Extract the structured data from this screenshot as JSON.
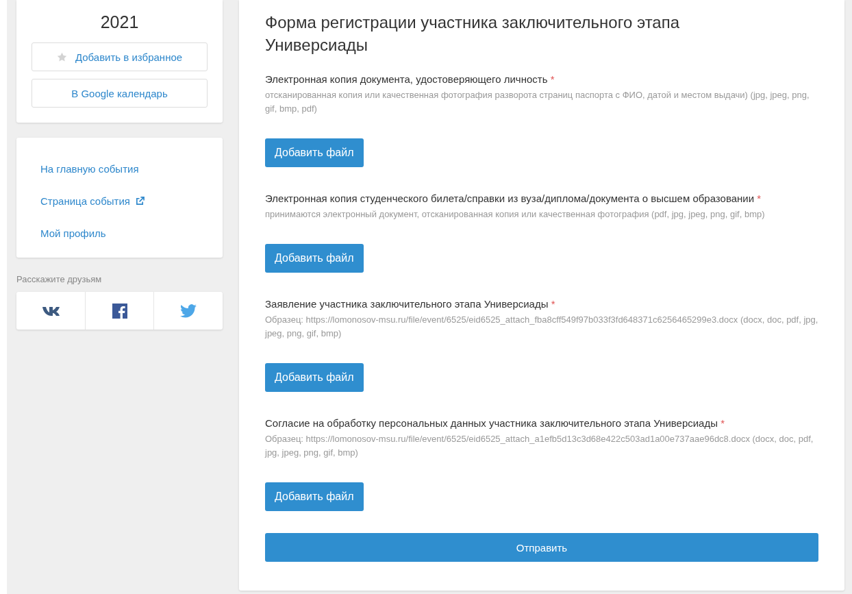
{
  "event_card": {
    "year": "2021",
    "buttons": [
      {
        "label": "Добавить в избранное",
        "kind": "favorite"
      },
      {
        "label": "В Google календарь",
        "kind": "calendar"
      }
    ]
  },
  "nav_links": [
    {
      "label": "На главную события",
      "external": false
    },
    {
      "label": "Страница события",
      "external": true
    },
    {
      "label": "Мой профиль",
      "external": false
    }
  ],
  "share": {
    "label": "Расскажите друзьям",
    "networks": [
      {
        "kind": "vk"
      },
      {
        "kind": "facebook"
      },
      {
        "kind": "twitter"
      }
    ]
  },
  "form": {
    "title": "Форма регистрации участника заключительного этапа Универсиады",
    "fields": [
      {
        "label": "Электронная копия документа, удостоверяющего личность",
        "marker": "*",
        "hint": "отсканированная копия или качественная фотография разворота страниц паспорта с ФИО, датой и местом выдачи) (jpg, jpeg, png, gif, bmp, pdf)",
        "button": "Добавить файл"
      },
      {
        "label": "Электронная копия студенческого билета/справки из вуза/диплома/документа о высшем образовании",
        "marker": "*",
        "hint": "принимаются электронный документ, отсканированная копия или качественная фотография (pdf, jpg, jpeg, png, gif, bmp)",
        "button": "Добавить файл"
      },
      {
        "label": "Заявление участника заключительного этапа Универсиады",
        "marker": "*",
        "hint": "Образец: https://lomonosov-msu.ru/file/event/6525/eid6525_attach_fba8cff549f97b033f3fd648371c6256465299e3.docx (docx, doc, pdf, jpg, jpeg, png, gif, bmp)",
        "button": "Добавить файл"
      },
      {
        "label": "Согласие на обработку персональных данных участника заключительного этапа Универсиады",
        "marker": "*",
        "hint": "Образец: https://lomonosov-msu.ru/file/event/6525/eid6525_attach_a1efb5d13c3d68e422c503ad1a00e737aae96dc8.docx (docx, doc, pdf, jpg, jpeg, png, gif, bmp)",
        "button": "Добавить файл"
      }
    ],
    "submit": "Отправить"
  }
}
